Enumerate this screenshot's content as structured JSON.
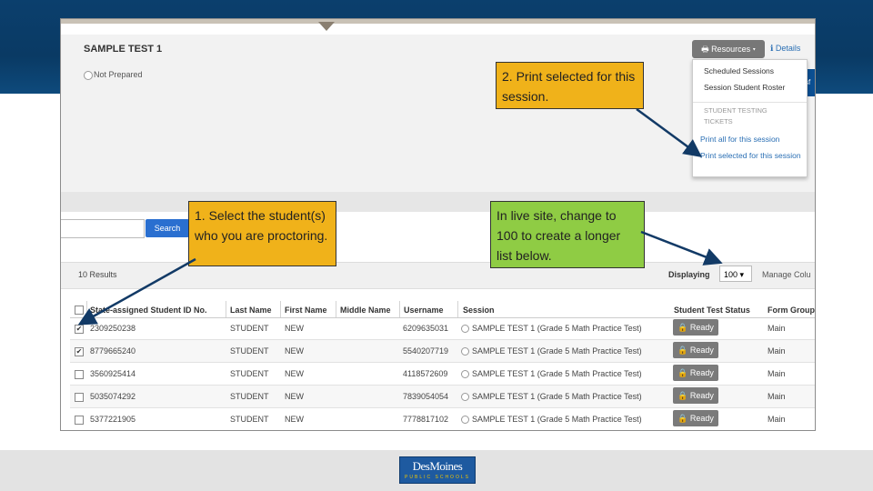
{
  "colors": {
    "header_blue": "#0b3f6d",
    "callout_yellow": "#f0b21a",
    "callout_green": "#8fcc44",
    "button_blue": "#2a6fd0",
    "arrow": "#123a66"
  },
  "logo": {
    "text": "DesMoines",
    "subtext": "PUBLIC SCHOOLS"
  },
  "screen": {
    "title": "SAMPLE TEST 1",
    "status": "Not Prepared",
    "resources_button": "Resources",
    "details_link": "Details",
    "blue_edge_text": "sf",
    "dropdown": {
      "item1": "Scheduled Sessions",
      "item2": "Session Student Roster",
      "header": "STUDENT TESTING TICKETS",
      "link1": "Print all for this session",
      "link2": "Print selected for this session"
    },
    "search_button": "Search",
    "results": "10 Results",
    "displaying_label": "Displaying",
    "displaying_value": "100",
    "manage_columns": "Manage Colu",
    "columns": [
      "State-assigned Student ID No.",
      "Last Name",
      "First Name",
      "Middle Name",
      "Username",
      "Session",
      "Student Test Status",
      "Form Group"
    ],
    "rows": [
      {
        "checked": "✔",
        "id": "2309250238",
        "last": "STUDENT",
        "first": "NEW",
        "username": "6209635031",
        "session": "SAMPLE TEST 1 (Grade 5 Math Practice Test)",
        "status": "Ready",
        "form": "Main"
      },
      {
        "checked": "✔",
        "id": "8779665240",
        "last": "STUDENT",
        "first": "NEW",
        "username": "5540207719",
        "session": "SAMPLE TEST 1 (Grade 5 Math Practice Test)",
        "status": "Ready",
        "form": "Main"
      },
      {
        "checked": "",
        "id": "3560925414",
        "last": "STUDENT",
        "first": "NEW",
        "username": "4118572609",
        "session": "SAMPLE TEST 1 (Grade 5 Math Practice Test)",
        "status": "Ready",
        "form": "Main"
      },
      {
        "checked": "",
        "id": "5035074292",
        "last": "STUDENT",
        "first": "NEW",
        "username": "7839054054",
        "session": "SAMPLE TEST 1 (Grade 5 Math Practice Test)",
        "status": "Ready",
        "form": "Main"
      },
      {
        "checked": "",
        "id": "5377221905",
        "last": "STUDENT",
        "first": "NEW",
        "username": "7778817102",
        "session": "SAMPLE TEST 1 (Grade 5 Math Practice Test)",
        "status": "Ready",
        "form": "Main"
      }
    ]
  },
  "callouts": {
    "print": "2. Print selected for this session.",
    "select": "1. Select the student(s) who you are proctoring.",
    "live": "In live site, change to 100 to create a longer list below."
  }
}
